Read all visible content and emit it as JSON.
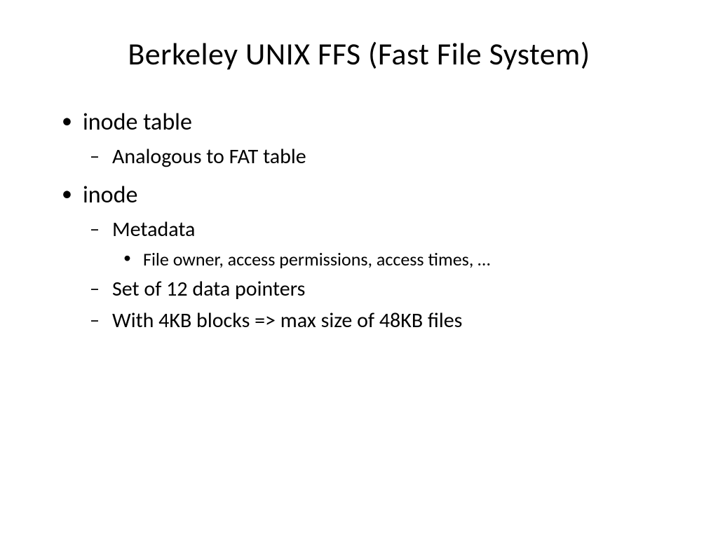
{
  "slide": {
    "title": "Berkeley UNIX FFS (Fast File System)",
    "bullets": [
      {
        "level": 1,
        "text": "inode table"
      },
      {
        "level": 2,
        "text": "Analogous to FAT table"
      },
      {
        "level": 1,
        "text": "inode"
      },
      {
        "level": 2,
        "text": "Metadata"
      },
      {
        "level": 3,
        "text": "File owner, access permissions, access times, …"
      },
      {
        "level": 2,
        "text": "Set of 12 data pointers"
      },
      {
        "level": 2,
        "text": "With 4KB blocks => max size of 48KB files"
      }
    ]
  }
}
